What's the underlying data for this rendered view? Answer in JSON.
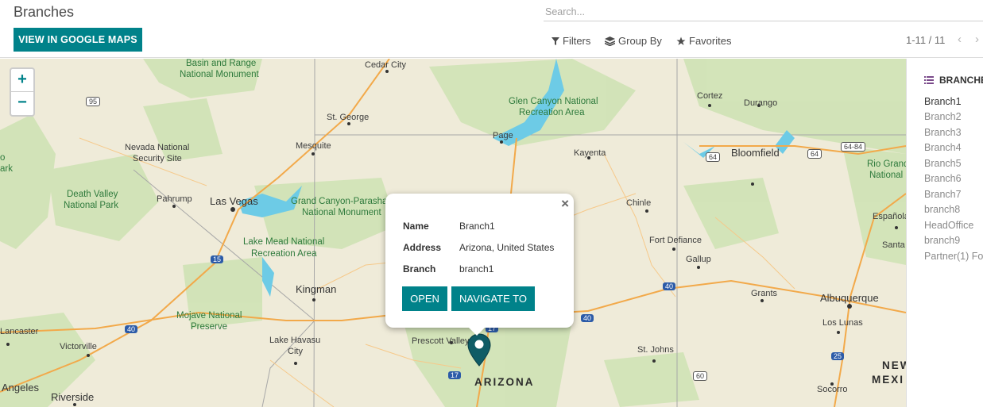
{
  "header": {
    "title": "Branches",
    "google_maps_button": "VIEW IN GOOGLE MAPS",
    "search_placeholder": "Search...",
    "filters_label": "Filters",
    "groupby_label": "Group By",
    "favorites_label": "Favorites",
    "pager": "1-11 / 11"
  },
  "map": {
    "zoom_in": "+",
    "zoom_out": "−",
    "labels": [
      {
        "text": "Basin and Range",
        "kind": "park"
      },
      {
        "text": "National Monument",
        "kind": "park"
      },
      {
        "text": "Cedar City",
        "kind": "place"
      },
      {
        "text": "Glen Canyon National",
        "kind": "park"
      },
      {
        "text": "Recreation Area",
        "kind": "park"
      },
      {
        "text": "Cortez",
        "kind": "place"
      },
      {
        "text": "Durango",
        "kind": "place"
      },
      {
        "text": "St. George",
        "kind": "place"
      },
      {
        "text": "Nevada National",
        "kind": "place"
      },
      {
        "text": "Security Site",
        "kind": "place"
      },
      {
        "text": "Mesquite",
        "kind": "place"
      },
      {
        "text": "Page",
        "kind": "place"
      },
      {
        "text": "Kayenta",
        "kind": "place"
      },
      {
        "text": "Bloomfield",
        "kind": "place"
      },
      {
        "text": "Death Valley",
        "kind": "park"
      },
      {
        "text": "National Park",
        "kind": "park"
      },
      {
        "text": "Pahrump",
        "kind": "place"
      },
      {
        "text": "Las Vegas",
        "kind": "city"
      },
      {
        "text": "Grand Canyon-Parasha",
        "kind": "park"
      },
      {
        "text": "National Monument",
        "kind": "park"
      },
      {
        "text": "Chinle",
        "kind": "place"
      },
      {
        "text": "Rio Grand",
        "kind": "park"
      },
      {
        "text": "National",
        "kind": "park"
      },
      {
        "text": "Lake Mead National",
        "kind": "park"
      },
      {
        "text": "Recreation Area",
        "kind": "park"
      },
      {
        "text": "Fort Defiance",
        "kind": "place"
      },
      {
        "text": "Gallup",
        "kind": "place"
      },
      {
        "text": "Española",
        "kind": "place"
      },
      {
        "text": "Santa",
        "kind": "place"
      },
      {
        "text": "Kingman",
        "kind": "place"
      },
      {
        "text": "Grants",
        "kind": "place"
      },
      {
        "text": "Albuquerque",
        "kind": "city"
      },
      {
        "text": "Mojave National",
        "kind": "park"
      },
      {
        "text": "Preserve",
        "kind": "park"
      },
      {
        "text": "Lancaster",
        "kind": "place"
      },
      {
        "text": "Lake Havasu",
        "kind": "place"
      },
      {
        "text": "City",
        "kind": "place"
      },
      {
        "text": "Los Lunas",
        "kind": "place"
      },
      {
        "text": "Victorville",
        "kind": "place"
      },
      {
        "text": "Prescott Valley",
        "kind": "place"
      },
      {
        "text": "St. Johns",
        "kind": "place"
      },
      {
        "text": "Angeles",
        "kind": "city"
      },
      {
        "text": "Riverside",
        "kind": "place"
      },
      {
        "text": "ARIZONA",
        "kind": "state"
      },
      {
        "text": "Socorro",
        "kind": "place"
      },
      {
        "text": "NEW",
        "kind": "state"
      },
      {
        "text": "MEXI",
        "kind": "state"
      },
      {
        "text": "ark",
        "kind": "park"
      },
      {
        "text": "o",
        "kind": "park"
      }
    ],
    "shields": [
      "95",
      "15",
      "40",
      "40",
      "40",
      "17",
      "17",
      "64",
      "64",
      "64-84",
      "60",
      "25"
    ]
  },
  "popup": {
    "close": "×",
    "rows": [
      {
        "key": "Name",
        "value": "Branch1"
      },
      {
        "key": "Address",
        "value": "Arizona, United States"
      },
      {
        "key": "Branch",
        "value": "branch1"
      }
    ],
    "open_button": "OPEN",
    "navigate_button": "NAVIGATE TO"
  },
  "sidebar": {
    "header": "BRANCHES",
    "items": [
      "Branch1",
      "Branch2",
      "Branch3",
      "Branch4",
      "Branch5",
      "Branch6",
      "Branch7",
      "branch8",
      "HeadOffice",
      "branch9",
      "Partner(1) Fo"
    ]
  },
  "colors": {
    "accent": "#00828a",
    "map_bg": "#efebd9",
    "park_green": "#cfe3b5",
    "water": "#6dcbe6",
    "road": "#f2a94a"
  }
}
